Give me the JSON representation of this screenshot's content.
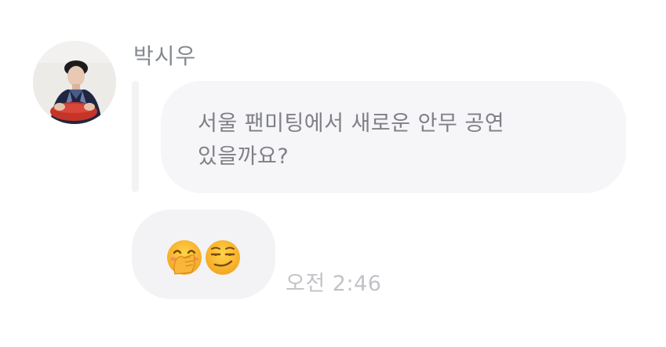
{
  "message": {
    "sender_name": "박시우",
    "quoted_text": "서울 팬미팅에서 새로운 안무 공연\n있을까요?",
    "emojis": [
      {
        "icon": "hand-over-mouth-emoji"
      },
      {
        "icon": "smirking-face-emoji"
      }
    ],
    "timestamp": "오전 2:46"
  },
  "colors": {
    "name_text": "#868990",
    "bubble_bg": "#f6f6f8",
    "timestamp_text": "#c2c3c7"
  }
}
